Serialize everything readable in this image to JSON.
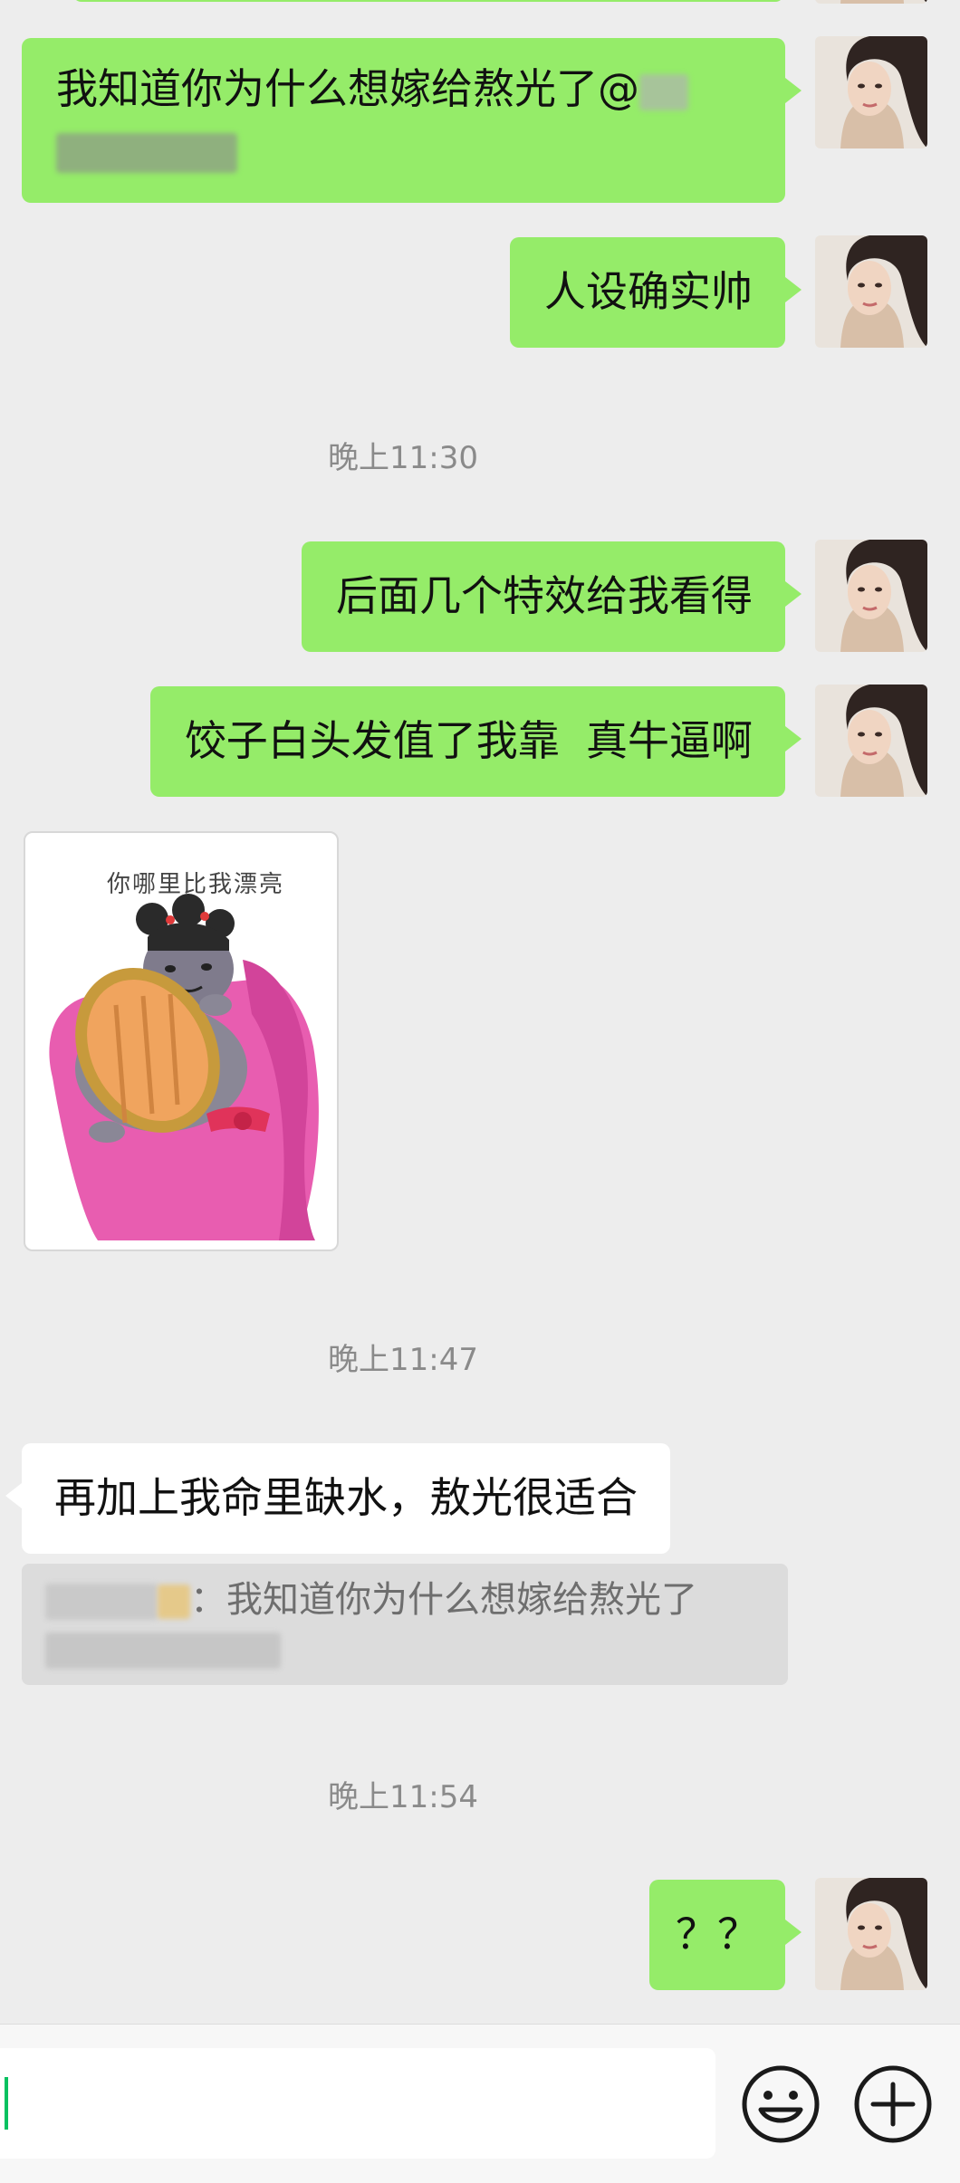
{
  "messages": {
    "m1": {
      "text": "我知道你为什么想嫁给熬光了@"
    },
    "m2": {
      "text": "人设确实帅"
    },
    "m3": {
      "text": "后面几个特效给我看得"
    },
    "m4": {
      "text": "饺子白头发值了我靠  真牛逼啊"
    },
    "sticker": {
      "caption": "你哪里比我漂亮"
    },
    "m5": {
      "text": "再加上我命里缺水，敖光很适合"
    },
    "quote": {
      "separator": "：",
      "text": "我知道你为什么想嫁给熬光了"
    },
    "m6": {
      "text": "？？"
    }
  },
  "timestamps": {
    "t1": "晚上11:30",
    "t2": "晚上11:47",
    "t3": "晚上11:54"
  },
  "colors": {
    "background": "#ededed",
    "outgoing_bubble": "#95ec69",
    "incoming_bubble": "#ffffff",
    "caret": "#07c160"
  },
  "input_bar": {
    "value": "",
    "emoji_icon": "emoji-icon",
    "add_icon": "plus-circle-icon"
  }
}
